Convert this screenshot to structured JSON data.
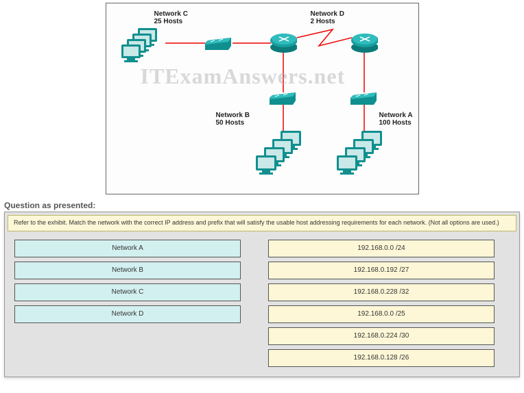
{
  "exhibit": {
    "labels": {
      "c": {
        "name": "Network C",
        "hosts": "25 Hosts"
      },
      "d": {
        "name": "Network D",
        "hosts": "2 Hosts"
      },
      "b": {
        "name": "Network B",
        "hosts": "50 Hosts"
      },
      "a": {
        "name": "Network A",
        "hosts": "100 Hosts"
      }
    },
    "watermark": "ITExamAnswers.net"
  },
  "question": {
    "header": "Question as presented:",
    "instruction": "Refer to the exhibit. Match the network with the correct IP address and prefix that will satisfy the usable host addressing requirements for each network. (Not all options are used.)",
    "drops": [
      {
        "label": "Network A"
      },
      {
        "label": "Network B"
      },
      {
        "label": "Network C"
      },
      {
        "label": "Network D"
      }
    ],
    "drags": [
      {
        "label": "192.168.0.0 /24"
      },
      {
        "label": "192.168.0.192 /27"
      },
      {
        "label": "192.168.0.228 /32"
      },
      {
        "label": "192.168.0.0 /25"
      },
      {
        "label": "192.168.0.224 /30"
      },
      {
        "label": "192.168.0.128 /26"
      }
    ],
    "faint_watermark": ""
  }
}
